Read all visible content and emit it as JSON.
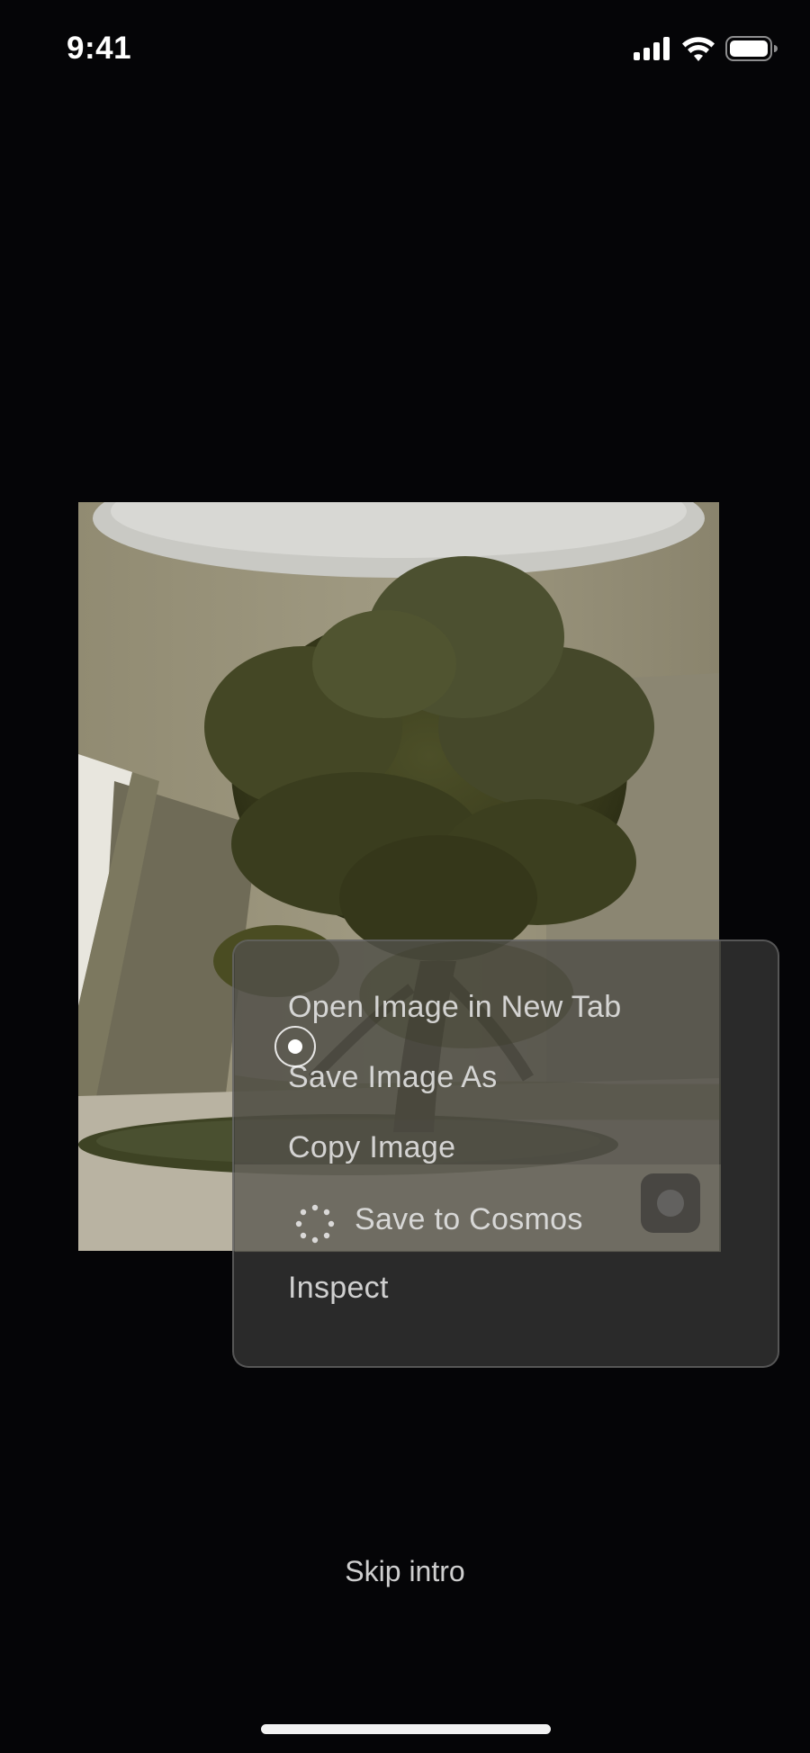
{
  "status_bar": {
    "time": "9:41",
    "icons": [
      "signal-icon",
      "wifi-icon",
      "battery-icon"
    ]
  },
  "photo": {
    "description_icon": "photo-image"
  },
  "context_menu": {
    "items": [
      {
        "label": "Open Image in New Tab"
      },
      {
        "label": "Save Image As"
      },
      {
        "label": "Copy Image"
      },
      {
        "label": "Save to Cosmos",
        "icon": "cosmos-dots-icon"
      },
      {
        "label": "Inspect"
      }
    ]
  },
  "footer": {
    "skip_label": "Skip intro"
  },
  "colors": {
    "background": "#050507",
    "menu_background": "#343434",
    "text": "#e6e6e6"
  }
}
